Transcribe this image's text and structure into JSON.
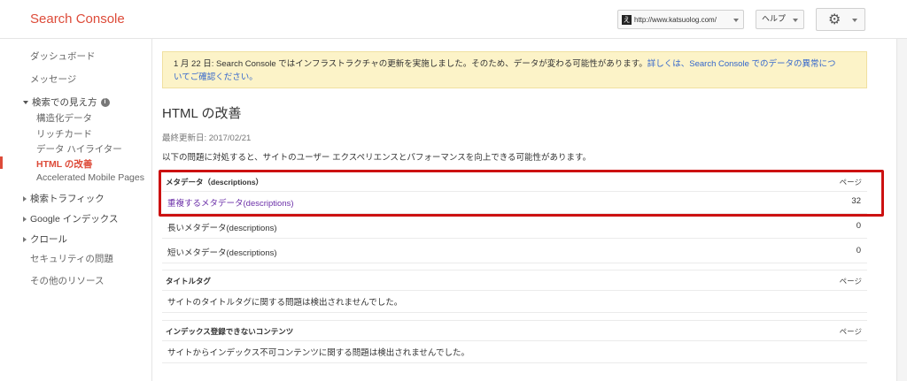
{
  "app": {
    "title": "Search Console"
  },
  "header": {
    "site_url": "http://www.katsuolog.com/",
    "site_favicon_glyph": "え",
    "help_label": "ヘルプ"
  },
  "sidebar": {
    "dashboard": "ダッシュボード",
    "messages": "メッセージ",
    "search_appearance": {
      "label": "検索での見え方",
      "items": [
        "構造化データ",
        "リッチカード",
        "データ ハイライター",
        "HTML の改善",
        "Accelerated Mobile Pages"
      ],
      "active": "HTML の改善"
    },
    "search_traffic": "検索トラフィック",
    "google_index": "Google インデックス",
    "crawl": "クロール",
    "security": "セキュリティの問題",
    "other_resources": "その他のリソース"
  },
  "notice": {
    "text": "1 月 22 日: Search Console ではインフラストラクチャの更新を実施しました。そのため、データが変わる可能性があります。",
    "link_text_1": "詳しくは、Search Console でのデータの異常につ",
    "link_text_2": "いてご確認ください。"
  },
  "main": {
    "title": "HTML の改善",
    "last_updated": "最終更新日: 2017/02/21",
    "intro": "以下の問題に対処すると、サイトのユーザー エクスペリエンスとパフォーマンスを向上できる可能性があります。",
    "sections": {
      "meta": {
        "header": "メタデータ（descriptions）",
        "col": "ページ",
        "rows": [
          {
            "label": "重複するメタデータ(descriptions)",
            "count": "32"
          },
          {
            "label": "長いメタデータ(descriptions)",
            "count": "0"
          },
          {
            "label": "短いメタデータ(descriptions)",
            "count": "0"
          }
        ]
      },
      "title_tag": {
        "header": "タイトルタグ",
        "col": "ページ",
        "message": "サイトのタイトルタグに関する問題は検出されませんでした。"
      },
      "non_indexable": {
        "header": "インデックス登録できないコンテンツ",
        "col": "ページ",
        "message": "サイトからインデックス不可コンテンツに関する問題は検出されませんでした。"
      }
    }
  },
  "colors": {
    "brand_red": "#dd4b39",
    "notice_bg": "#fcf3c8",
    "link_blue": "#3366cc",
    "visited_purple": "#6b2fa8",
    "highlight_red": "#cc1111"
  }
}
